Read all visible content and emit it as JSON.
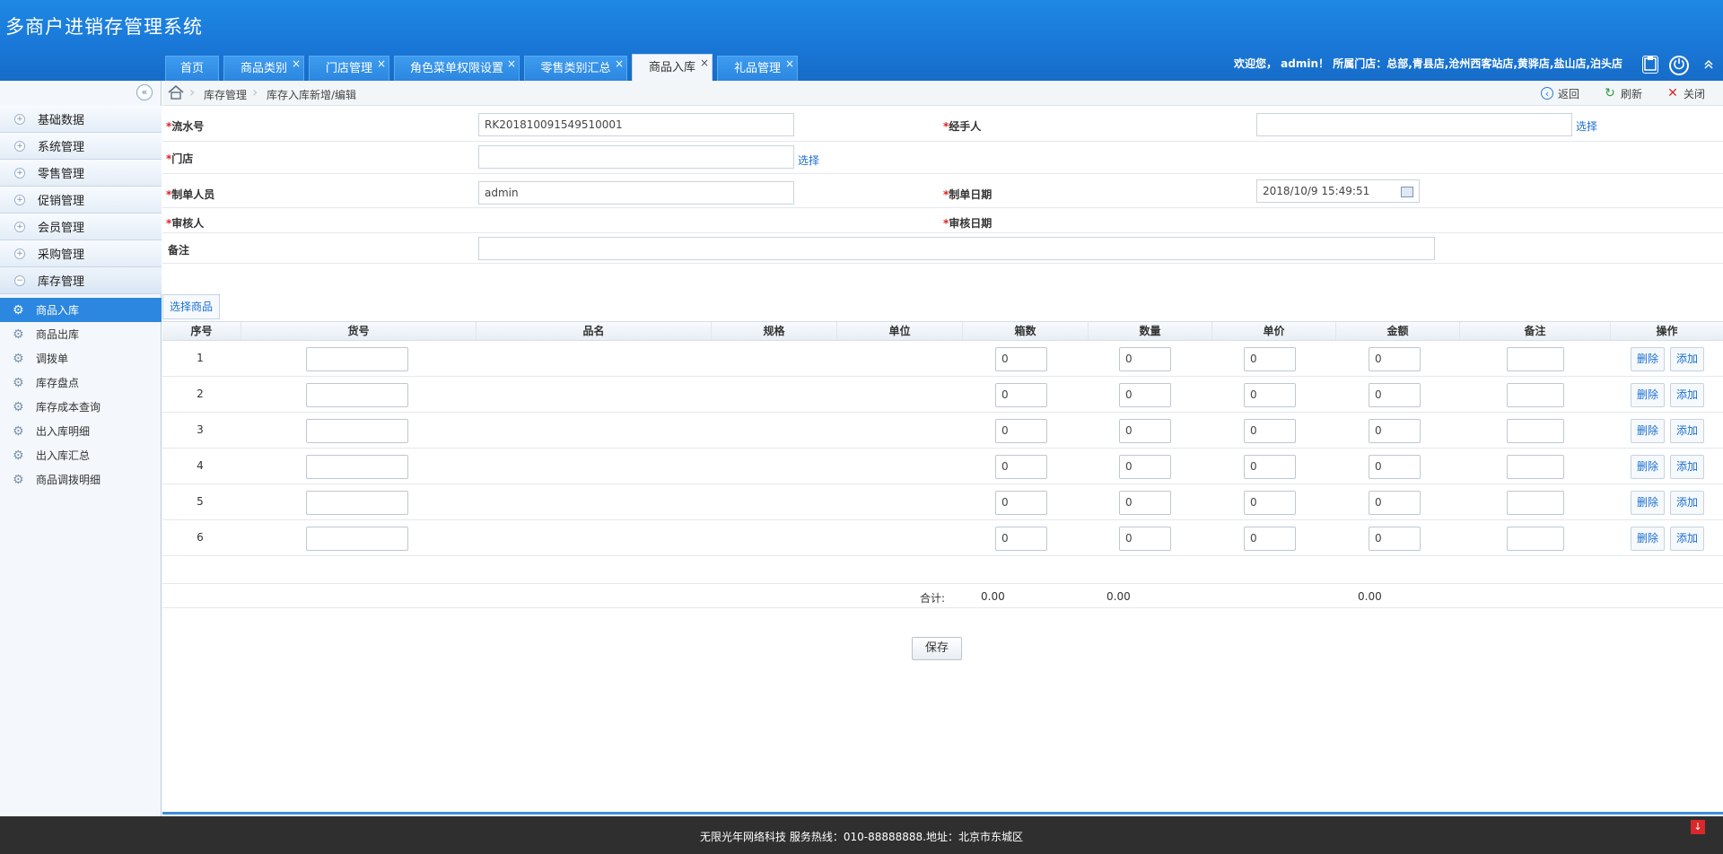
{
  "app": {
    "title": "多商户进销存管理系统"
  },
  "tabs": [
    {
      "label": "首页",
      "closable": false,
      "active": false
    },
    {
      "label": "商品类别",
      "closable": true,
      "active": false
    },
    {
      "label": "门店管理",
      "closable": true,
      "active": false
    },
    {
      "label": "角色菜单权限设置",
      "closable": true,
      "active": false
    },
    {
      "label": "零售类别汇总",
      "closable": true,
      "active": false
    },
    {
      "label": "商品入库",
      "closable": true,
      "active": true
    },
    {
      "label": "礼品管理",
      "closable": true,
      "active": false
    }
  ],
  "header": {
    "welcome": "欢迎您， admin！ 所属门店：总部,青县店,沧州西客站店,黄骅店,盐山店,泊头店",
    "close_glyph": "×"
  },
  "sidebar": {
    "groups": [
      {
        "label": "基础数据"
      },
      {
        "label": "系统管理"
      },
      {
        "label": "零售管理"
      },
      {
        "label": "促销管理"
      },
      {
        "label": "会员管理"
      },
      {
        "label": "采购管理"
      },
      {
        "label": "库存管理"
      }
    ],
    "items": [
      {
        "label": "商品入库",
        "active": true
      },
      {
        "label": "商品出库"
      },
      {
        "label": "调拨单"
      },
      {
        "label": "库存盘点"
      },
      {
        "label": "库存成本查询"
      },
      {
        "label": "出入库明细"
      },
      {
        "label": "出入库汇总"
      },
      {
        "label": "商品调拨明细"
      }
    ]
  },
  "breadcrumb": {
    "level1": "库存管理",
    "level2": "库存入库新增/编辑"
  },
  "toolbar": {
    "back": "返回",
    "refresh": "刷新",
    "close": "关闭"
  },
  "form": {
    "serial_label": "流水号",
    "serial_value": "RK201810091549510001",
    "handler_label": "经手人",
    "handler_value": "",
    "handler_link": "选择",
    "store_label": "门店",
    "store_value": "",
    "store_link": "选择",
    "creator_label": "制单人员",
    "creator_value": "admin",
    "create_date_label": "制单日期",
    "create_date_value": "2018/10/9 15:49:51",
    "auditor_label": "审核人",
    "audit_date_label": "审核日期",
    "remark_label": "备注",
    "remark_value": ""
  },
  "select_goods": "选择商品",
  "grid": {
    "headers": [
      "序号",
      "货号",
      "品名",
      "规格",
      "单位",
      "箱数",
      "数量",
      "单价",
      "金额",
      "备注",
      "操作"
    ],
    "rows": [
      {
        "seq": "1",
        "boxes": "0",
        "qty": "0",
        "price": "0",
        "amount": "0"
      },
      {
        "seq": "2",
        "boxes": "0",
        "qty": "0",
        "price": "0",
        "amount": "0"
      },
      {
        "seq": "3",
        "boxes": "0",
        "qty": "0",
        "price": "0",
        "amount": "0"
      },
      {
        "seq": "4",
        "boxes": "0",
        "qty": "0",
        "price": "0",
        "amount": "0"
      },
      {
        "seq": "5",
        "boxes": "0",
        "qty": "0",
        "price": "0",
        "amount": "0"
      },
      {
        "seq": "6",
        "boxes": "0",
        "qty": "0",
        "price": "0",
        "amount": "0"
      }
    ],
    "delete_label": "删除",
    "add_label": "添加"
  },
  "totals": {
    "label": "合计:",
    "boxes": "0.00",
    "qty": "0.00",
    "amount": "0.00"
  },
  "save_label": "保存",
  "footer": {
    "text": "无限光年网络科技 服务热线：010-88888888.地址：北京市东城区"
  }
}
